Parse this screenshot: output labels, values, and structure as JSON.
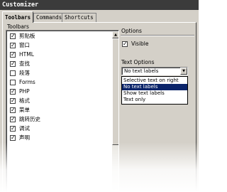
{
  "window": {
    "title": "Customizer"
  },
  "tabs": [
    {
      "label": "Toolbars",
      "active": true
    },
    {
      "label": "Commands",
      "active": false
    },
    {
      "label": "Shortcuts",
      "active": false
    }
  ],
  "toolbars": {
    "label": "Toolbars",
    "items": [
      {
        "label": "剪贴板",
        "checked": true
      },
      {
        "label": "窗口",
        "checked": true
      },
      {
        "label": "HTML",
        "checked": true
      },
      {
        "label": "查找",
        "checked": true
      },
      {
        "label": "段落",
        "checked": false
      },
      {
        "label": "Forms",
        "checked": false
      },
      {
        "label": "PHP",
        "checked": true
      },
      {
        "label": "格式",
        "checked": true
      },
      {
        "label": "菜单",
        "checked": true
      },
      {
        "label": "跳转历史",
        "checked": true
      },
      {
        "label": "调试",
        "checked": true
      },
      {
        "label": "声明",
        "checked": true
      }
    ]
  },
  "options": {
    "label": "Options",
    "visible_label": "Visible",
    "visible_checked": true,
    "text_options_label": "Text Options",
    "text_options_value": "No text labels",
    "text_options_list": [
      {
        "label": "Selective text on right",
        "selected": false
      },
      {
        "label": "No text labels",
        "selected": true
      },
      {
        "label": "Show text labels",
        "selected": false
      },
      {
        "label": "Text only",
        "selected": false
      }
    ]
  },
  "icons": {
    "check": "✓",
    "scroll_up": "▲",
    "dropdown_arrow": "▼"
  },
  "colors": {
    "title_bar": "#3b3b3b",
    "dialog_bg": "#d4d0c8",
    "selection": "#0a246a"
  }
}
